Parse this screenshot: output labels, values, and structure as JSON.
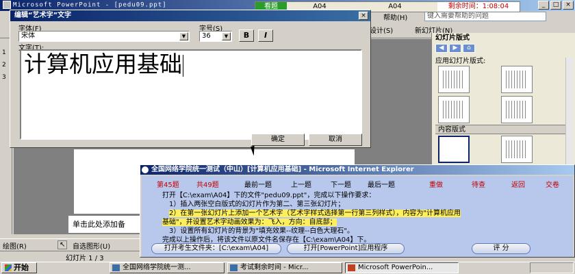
{
  "app": {
    "title": "Microsoft PowerPoint - [pedu09.ppt]",
    "controls": [
      "_",
      "□",
      "×"
    ]
  },
  "exam_timer": {
    "status": "看题",
    "code1": "A04",
    "code2": "A04",
    "remaining_label": "剩余时间：1:08:04"
  },
  "menubar": {
    "items": [
      "帮助(H)"
    ],
    "help_placeholder": "键入需要帮助的问题"
  },
  "toolbar": {
    "design_label": "设计(S)",
    "new_slide_label": "新幻灯片(N)"
  },
  "wordart_dialog": {
    "title": "编辑“艺术字”文字",
    "close": "×",
    "font_label": "字体(F)",
    "font_value": "宋体",
    "size_label": "字号(S)",
    "size_value": "36",
    "bold": "B",
    "italic": "I",
    "text_label": "文字(T):",
    "text_value": "计算机应用基础",
    "ok": "确定",
    "cancel": "取消"
  },
  "task_pane": {
    "title": "幻灯片版式",
    "nav": [
      "◀",
      "▶",
      "⌂"
    ],
    "apply_label": "应用幻灯片版式:",
    "content_section": "内容版式"
  },
  "outline_numbers": [
    "1",
    "2",
    "3"
  ],
  "notes_placeholder": "单击此处添加备",
  "exam_window": {
    "title": "全国网络学院统一测试（中山）[计算机应用基础] - Microsoft Internet Explorer",
    "question_no": "第45题",
    "total": "共49题",
    "nav": [
      "最前一题",
      "上一题",
      "下一题",
      "最后一题"
    ],
    "actions": [
      "重做",
      "待查",
      "返回",
      "交卷"
    ],
    "instructions": [
      "打开【C:\\exam\\A04】下的文件\"pedu09.ppt\"，完成以下操作要求：",
      "1）插入两张空白版式的幻灯片作为第二、第三张幻灯片；",
      "2）在第一张幻灯片上添加一个艺术字（艺术字样式选择第一行第三列样式），内容为\"计算机应用",
      "基础\"，并设置艺术字动画效果为：飞入，方向：自底部；",
      "3）设置所有幻灯片的背景为\"填充效果--纹理--白色大理石\"。",
      "完成以上操作后，将该文件以原文件名保存在【C:\\exam\\A04】下。"
    ],
    "open_folder_button": "打开考生文件夹：[C:\\exam\\A04]",
    "open_app_button": "打开[PowerPoint]应用程序",
    "score_button": "评 分"
  },
  "draw_toolbar": {
    "draw": "绘图(R)",
    "autoshapes": "自选图形(U)"
  },
  "status": {
    "slide": "幻灯片 1 / 3"
  },
  "taskbar": {
    "start": "开始",
    "items": [
      "全国网络学院统一测...",
      "考试剩余时间 - Micr...",
      "Microsoft PowerPoin..."
    ]
  },
  "colors": {
    "titlebar": "#0a246a",
    "timer_green": "#2a9c2a",
    "exam_red": "#c00000",
    "exam_body": "#b8c8ec",
    "highlight": "#ffef5a"
  }
}
